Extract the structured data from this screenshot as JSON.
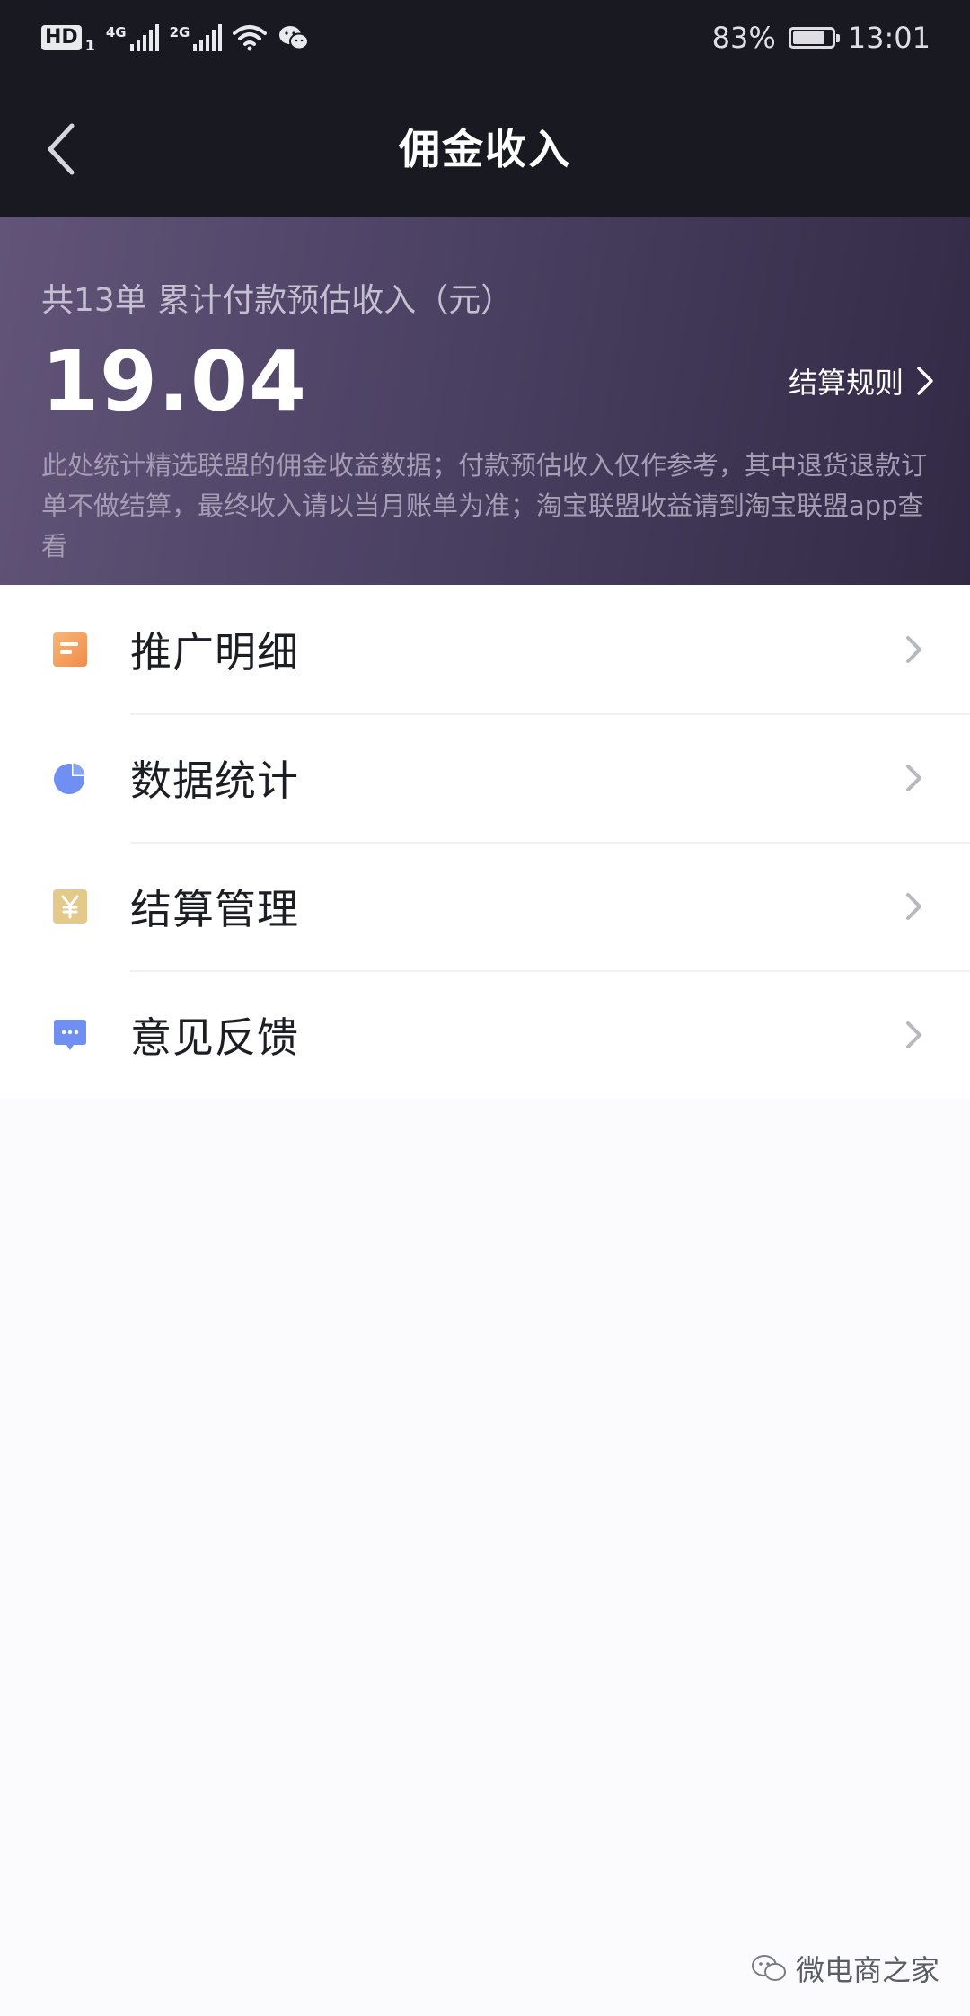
{
  "status_bar": {
    "hd_label": "HD",
    "sim_number": "1",
    "network_1": "4G",
    "network_2": "2G",
    "battery_percent": "83%",
    "battery_level": 0.83,
    "time": "13:01"
  },
  "app_bar": {
    "title": "佣金收入"
  },
  "summary": {
    "label": "共13单 累计付款预估收入（元）",
    "amount": "19.04",
    "rules_link": "结算规则",
    "note": "此处统计精选联盟的佣金收益数据；付款预估收入仅作参考，其中退货退款订单不做结算，最终收入请以当月账单为准；淘宝联盟收益请到淘宝联盟app查看"
  },
  "menu": [
    {
      "label": "推广明细",
      "icon": "document-icon",
      "color": "#f5a15d"
    },
    {
      "label": "数据统计",
      "icon": "pie-chart-icon",
      "color": "#6f8ff2"
    },
    {
      "label": "结算管理",
      "icon": "yen-icon",
      "color": "#e3c98a"
    },
    {
      "label": "意见反馈",
      "icon": "chat-bubble-icon",
      "color": "#6f8ff2"
    }
  ],
  "watermark": {
    "text": "微电商之家"
  }
}
